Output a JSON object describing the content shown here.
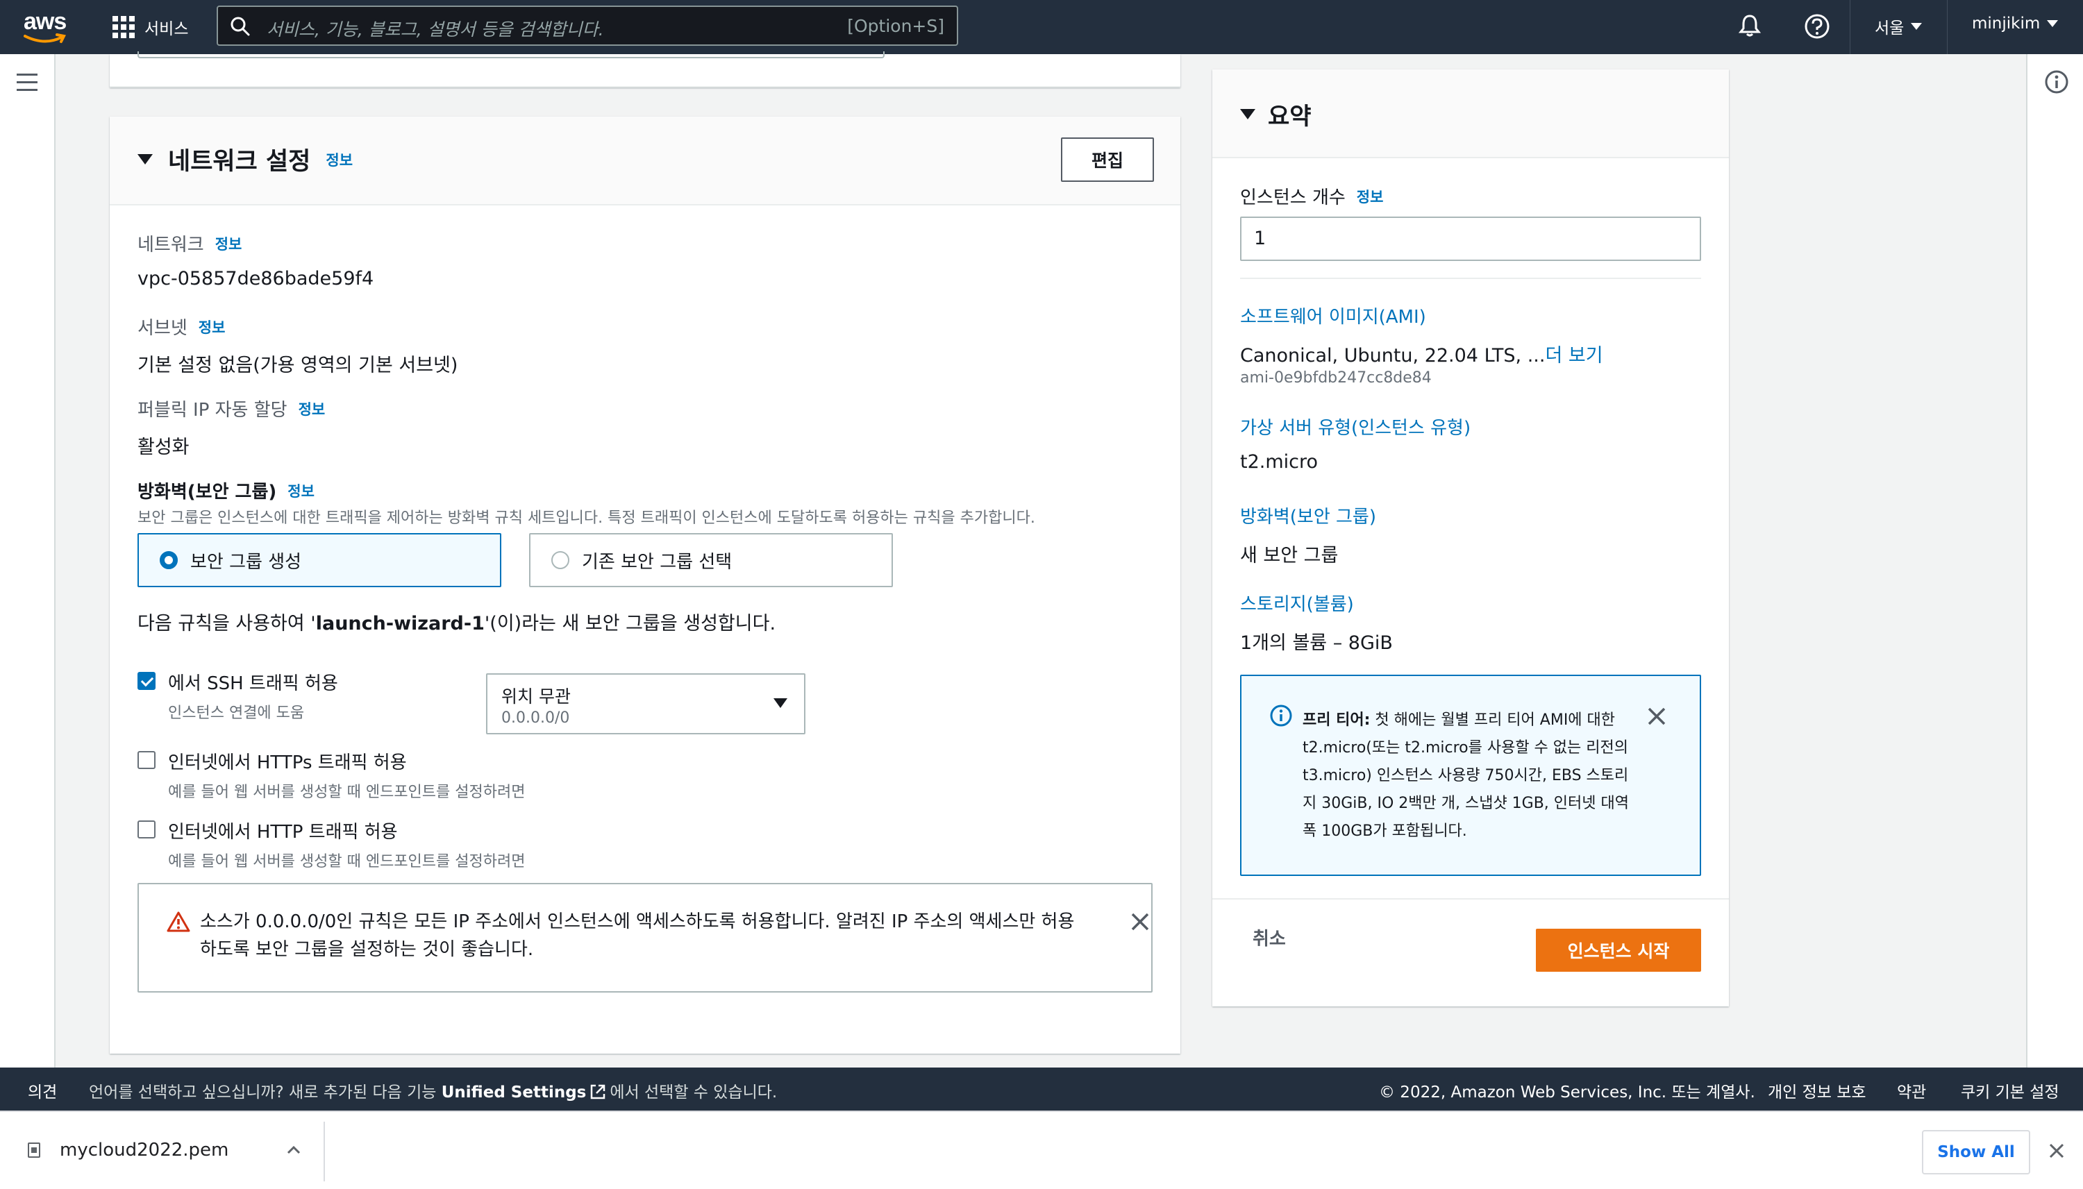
{
  "topnav": {
    "logo_text": "aws",
    "services_label": "서비스",
    "search_placeholder": "서비스, 기능, 블로그, 설명서 등을 검색합니다.",
    "search_shortcut": "[Option+S]",
    "region": "서울",
    "user": "minjikim"
  },
  "network": {
    "title": "네트워크 설정",
    "info": "정보",
    "edit_button": "편집",
    "network_label": "네트워크",
    "network_value": "vpc-05857de86bade59f4",
    "subnet_label": "서브넷",
    "subnet_value": "기본 설정 없음(가용 영역의 기본 서브넷)",
    "public_ip_label": "퍼블릭 IP 자동 할당",
    "public_ip_value": "활성화",
    "firewall_label": "방화벽(보안 그룹)",
    "firewall_desc": "보안 그룹은 인스턴스에 대한 트래픽을 제어하는 방화벽 규칙 세트입니다. 특정 트래픽이 인스턴스에 도달하도록 허용하는 규칙을 추가합니다.",
    "radio_create": "보안 그룹 생성",
    "radio_existing": "기존 보안 그룹 선택",
    "sg_text_pre": "다음 규칙을 사용하여 '",
    "sg_name": "launch-wizard-1",
    "sg_text_post": "'(이)라는 새 보안 그룹을 생성합니다.",
    "ssh_label": "에서 SSH 트래픽 허용",
    "ssh_desc": "인스턴스 연결에 도움",
    "ssh_source": "위치 무관",
    "ssh_source_cidr": "0.0.0.0/0",
    "https_label": "인터넷에서 HTTPs 트래픽 허용",
    "https_desc": "예를 들어 웹 서버를 생성할 때 엔드포인트를 설정하려면",
    "http_label": "인터넷에서 HTTP 트래픽 허용",
    "http_desc": "예를 들어 웹 서버를 생성할 때 엔드포인트를 설정하려면",
    "warning": "소스가 0.0.0.0/0인 규칙은 모든 IP 주소에서 인스턴스에 액세스하도록 허용합니다. 알려진 IP 주소의 액세스만 허용하도록 보안 그룹을 설정하는 것이 좋습니다."
  },
  "summary": {
    "title": "요약",
    "instance_count_label": "인스턴스 개수",
    "info": "정보",
    "instance_count": "1",
    "ami_label": "소프트웨어 이미지(AMI)",
    "ami_value": "Canonical, Ubuntu, 22.04 LTS, ...",
    "ami_more": "더 보기",
    "ami_id": "ami-0e9bfdb247cc8de84",
    "type_label": "가상 서버 유형(인스턴스 유형)",
    "type_value": "t2.micro",
    "firewall_label": "방화벽(보안 그룹)",
    "firewall_value": "새 보안 그룹",
    "storage_label": "스토리지(볼륨)",
    "storage_value": "1개의 볼륨 – 8GiB",
    "free_tier_bold": "프리 티어:",
    "free_tier_text": " 첫 해에는 월별 프리 티어 AMI에 대한 t2.micro(또는 t2.micro를 사용할 수 없는 리전의 t3.micro) 인스턴스 사용량 750시간, EBS 스토리지 30GiB, IO 2백만 개, 스냅샷 1GB, 인터넷 대역폭 100GB가 포함됩니다.",
    "cancel_button": "취소",
    "launch_button": "인스턴스 시작"
  },
  "footer": {
    "feedback": "의견",
    "lang_pre": "언어를 선택하고 싶으십니까? 새로 추가된 다음 기능 ",
    "lang_link": "Unified Settings",
    "lang_post": "에서 선택할 수 있습니다.",
    "copyright": "© 2022, Amazon Web Services, Inc. 또는 계열사.",
    "privacy": "개인 정보 보호",
    "terms": "약관",
    "cookies": "쿠키 기본 설정"
  },
  "downloads": {
    "file": "mycloud2022.pem",
    "show_all": "Show All"
  },
  "colors": {
    "nav_bg": "#232f3e",
    "accent_blue": "#0073bb",
    "launch_orange": "#ec7211",
    "warning_red": "#d13212"
  }
}
